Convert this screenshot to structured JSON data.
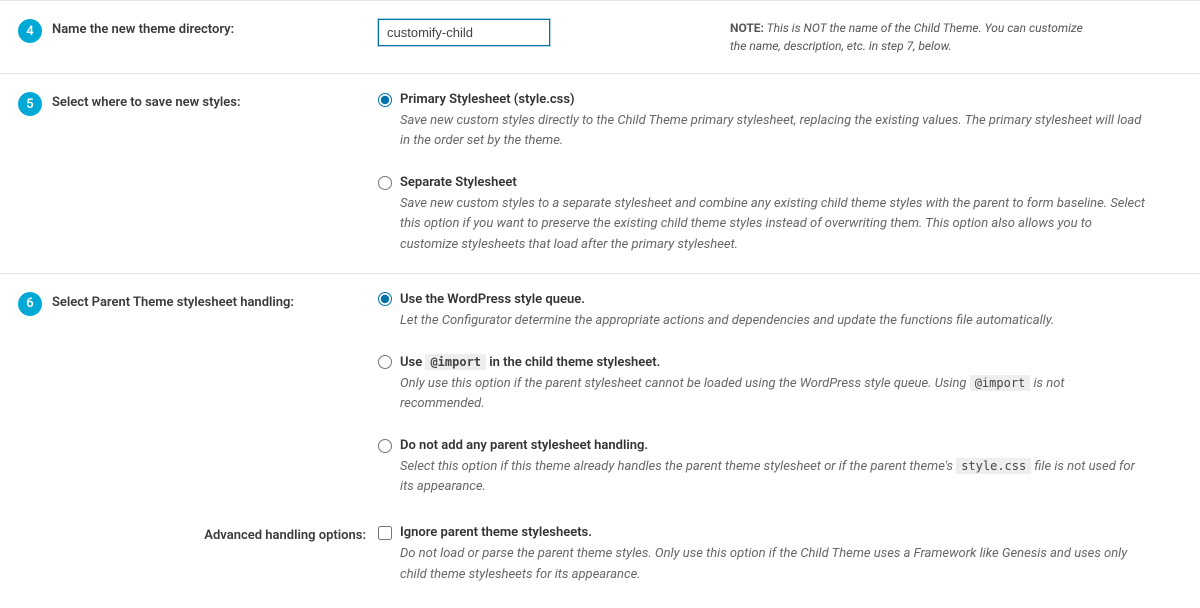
{
  "step4": {
    "number": "4",
    "label": "Name the new theme directory:",
    "input_value": "customify-child",
    "note_strong": "NOTE:",
    "note_text": "This is NOT the name of the Child Theme. You can customize the name, description, etc. in step 7, below."
  },
  "step5": {
    "number": "5",
    "label": "Select where to save new styles:",
    "options": [
      {
        "label": "Primary Stylesheet (style.css)",
        "desc": "Save new custom styles directly to the Child Theme primary stylesheet, replacing the existing values. The primary stylesheet will load in the order set by the theme."
      },
      {
        "label": "Separate Stylesheet",
        "desc": "Save new custom styles to a separate stylesheet and combine any existing child theme styles with the parent to form baseline. Select this option if you want to preserve the existing child theme styles instead of overwriting them. This option also allows you to customize stylesheets that load after the primary stylesheet."
      }
    ]
  },
  "step6": {
    "number": "6",
    "label": "Select Parent Theme stylesheet handling:",
    "options": [
      {
        "label": "Use the WordPress style queue.",
        "desc": "Let the Configurator determine the appropriate actions and dependencies and update the functions file automatically."
      },
      {
        "label_before": "Use ",
        "code": "@import",
        "label_after": " in the child theme stylesheet.",
        "desc_before": "Only use this option if the parent stylesheet cannot be loaded using the WordPress style queue. Using ",
        "desc_code": "@import",
        "desc_after": " is not recommended."
      },
      {
        "label": "Do not add any parent stylesheet handling.",
        "desc_before": "Select this option if this theme already handles the parent theme stylesheet or if the parent theme's ",
        "desc_code": "style.css",
        "desc_after": " file is not used for its appearance."
      }
    ],
    "advanced_label": "Advanced handling options:",
    "advanced": {
      "label": "Ignore parent theme stylesheets.",
      "desc": "Do not load or parse the parent theme styles. Only use this option if the Child Theme uses a Framework like Genesis and uses only child theme stylesheets for its appearance."
    }
  }
}
